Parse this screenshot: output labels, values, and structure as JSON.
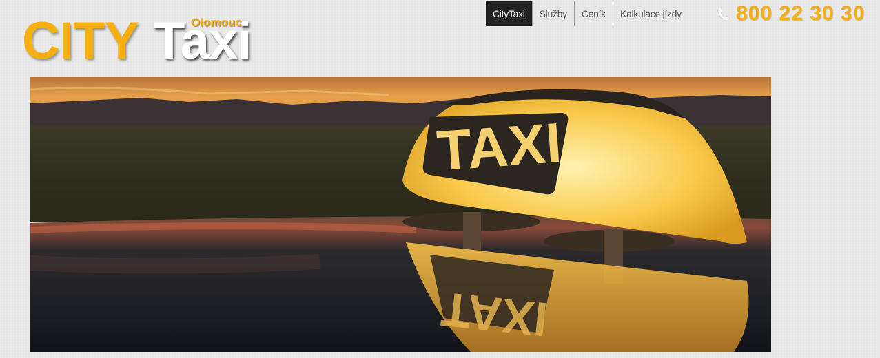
{
  "logo": {
    "city": "CITY",
    "taxi": "Taxi",
    "location": "Olomouc"
  },
  "nav": {
    "items": [
      {
        "label": "CityTaxi",
        "active": true
      },
      {
        "label": "Služby",
        "active": false
      },
      {
        "label": "Ceník",
        "active": false
      },
      {
        "label": "Kalkulace jízdy",
        "active": false
      }
    ]
  },
  "phone": {
    "icon": "phone-icon",
    "number": "800 22 30 30"
  },
  "hero": {
    "sign_text": "TAXI",
    "reflection_text": "TAXI"
  },
  "colors": {
    "brand": "#f5b00f",
    "nav_active_bg": "#222222"
  }
}
